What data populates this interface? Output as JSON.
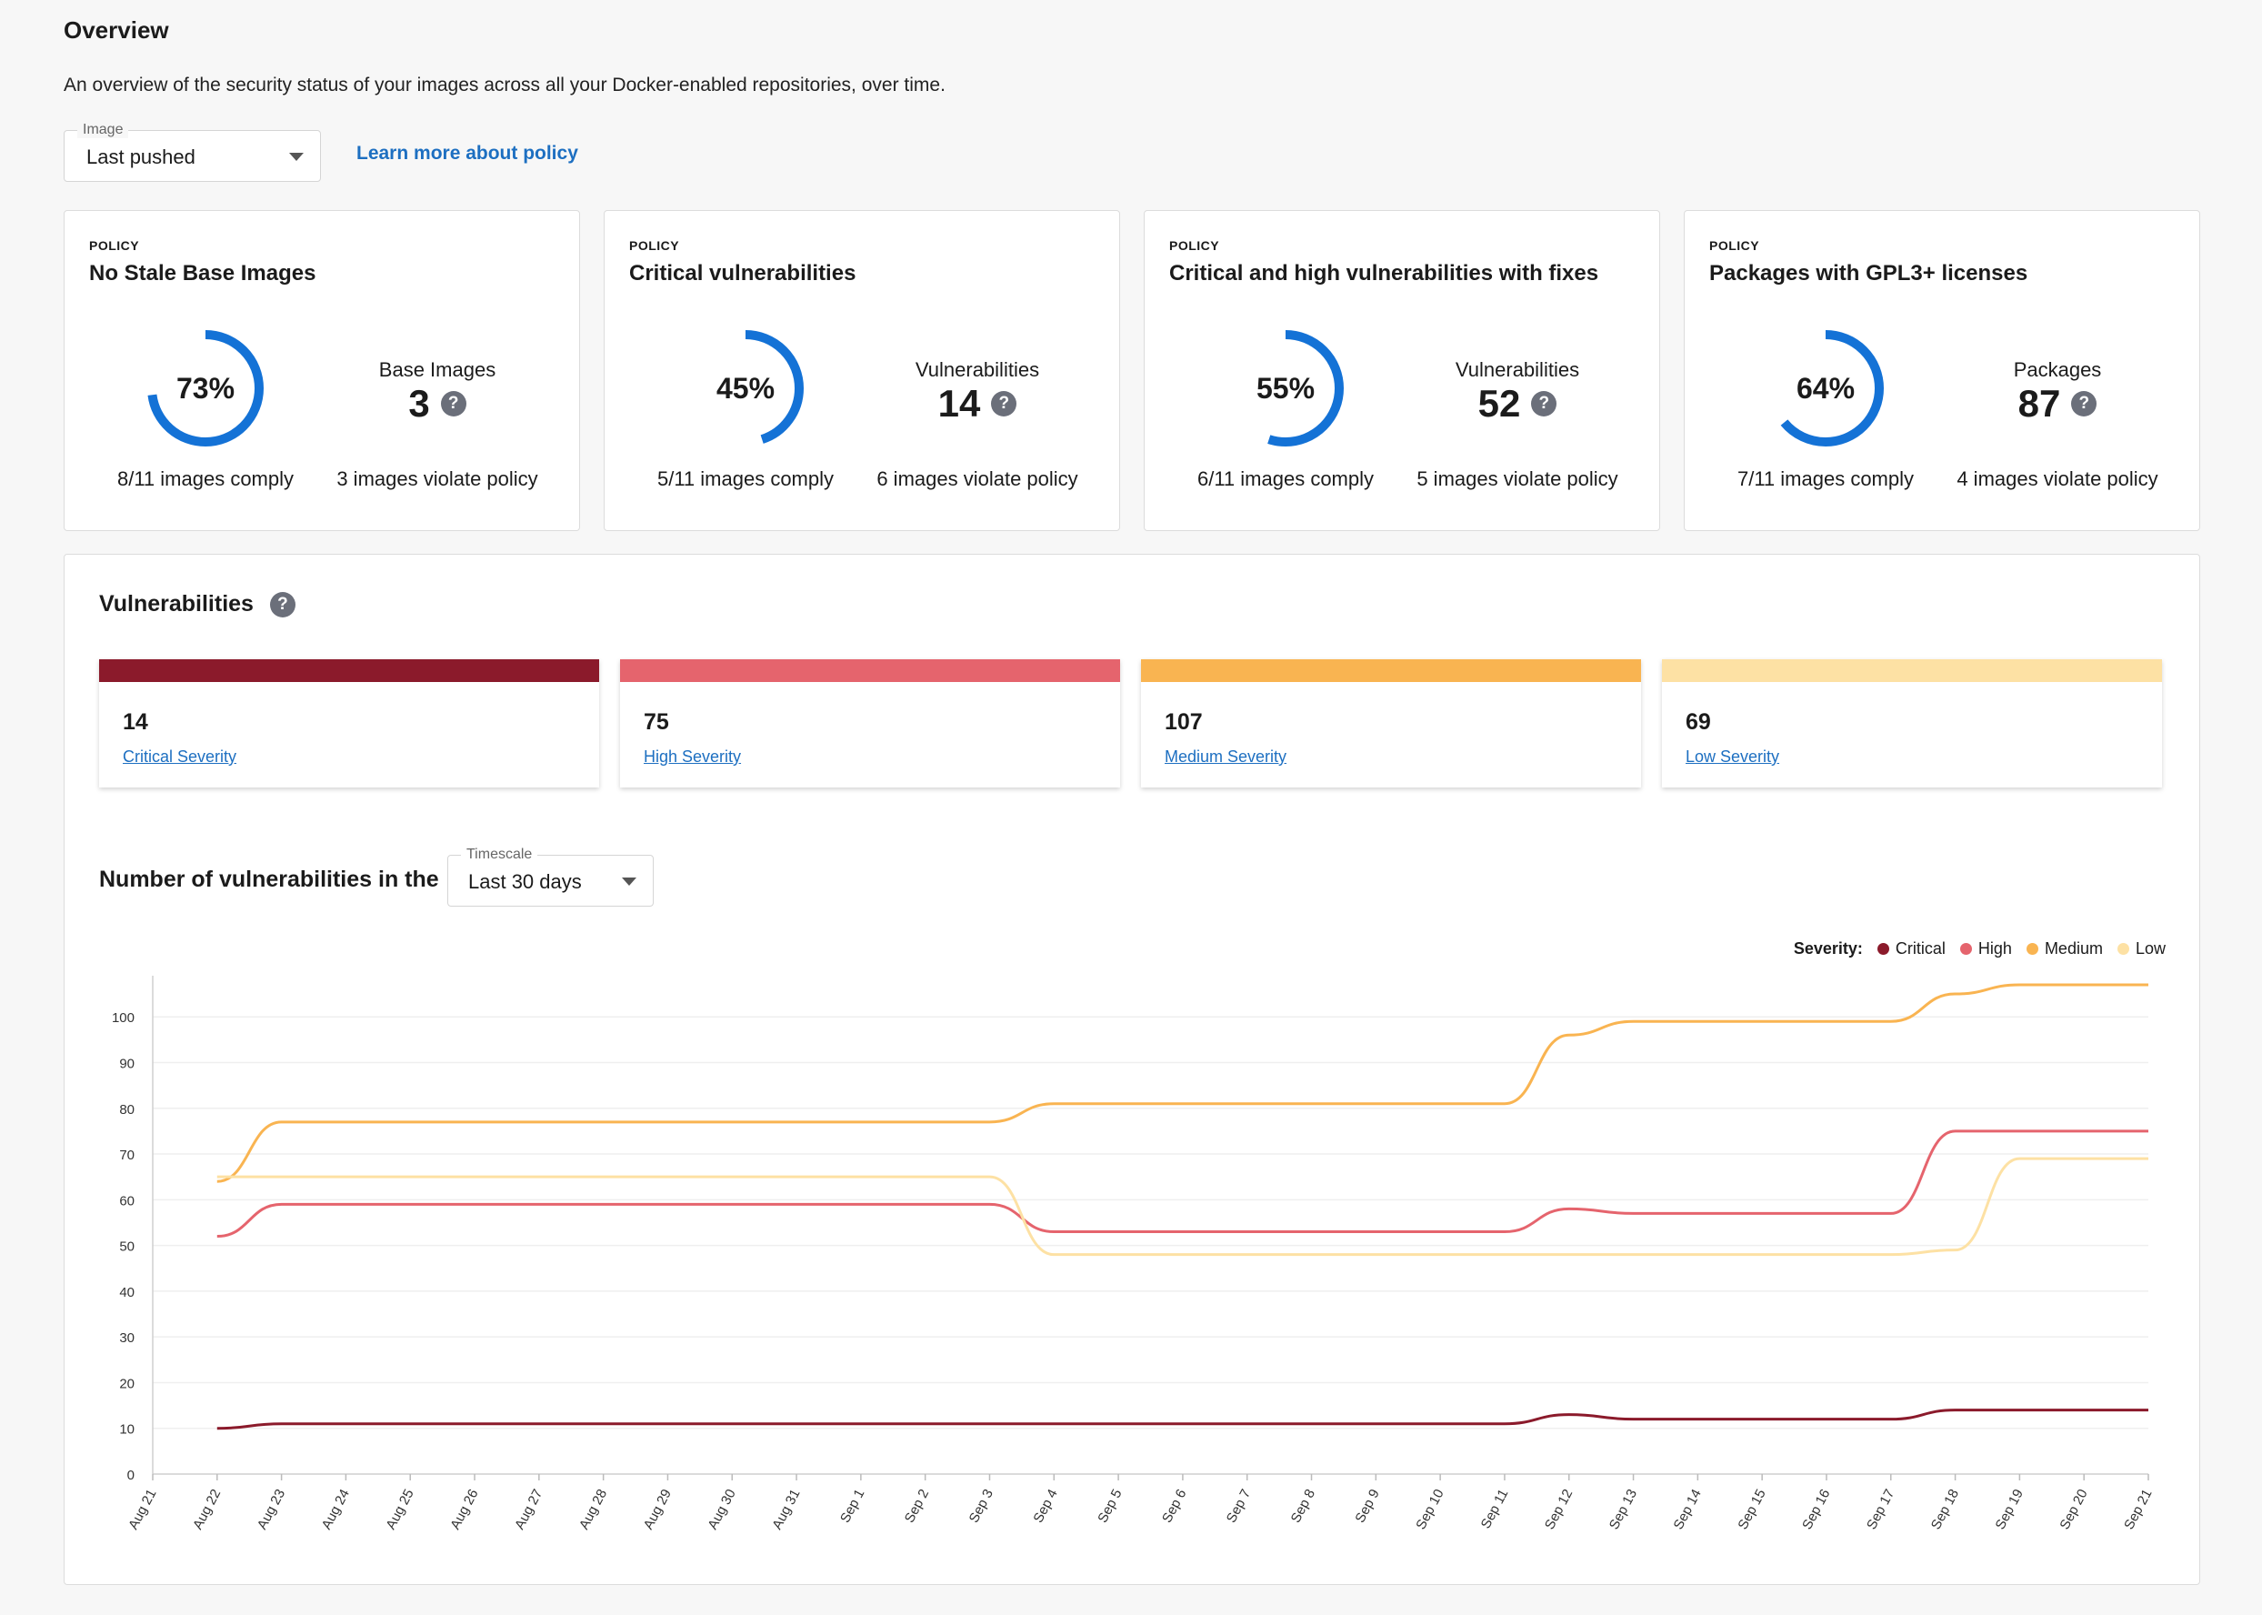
{
  "header": {
    "title": "Overview",
    "description": "An overview of the security status of your images across all your Docker-enabled repositories, over time.",
    "image_select": {
      "label": "Image",
      "value": "Last pushed"
    },
    "learn_more": "Learn more about policy"
  },
  "policies": [
    {
      "label": "POLICY",
      "name": "No Stale Base Images",
      "percent": "73%",
      "fraction": 0.73,
      "metric_label": "Base Images",
      "metric_value": "3",
      "comply": "8/11 images comply",
      "violate": "3 images violate policy"
    },
    {
      "label": "POLICY",
      "name": "Critical vulnerabilities",
      "percent": "45%",
      "fraction": 0.45,
      "metric_label": "Vulnerabilities",
      "metric_value": "14",
      "comply": "5/11 images comply",
      "violate": "6 images violate policy"
    },
    {
      "label": "POLICY",
      "name": "Critical and high vulnerabilities with fixes",
      "percent": "55%",
      "fraction": 0.55,
      "metric_label": "Vulnerabilities",
      "metric_value": "52",
      "comply": "6/11 images comply",
      "violate": "5 images violate policy"
    },
    {
      "label": "POLICY",
      "name": "Packages with GPL3+ licenses",
      "percent": "64%",
      "fraction": 0.64,
      "metric_label": "Packages",
      "metric_value": "87",
      "comply": "7/11 images comply",
      "violate": "4 images violate policy"
    }
  ],
  "vulnerabilities": {
    "title": "Vulnerabilities",
    "severities": [
      {
        "count": "14",
        "label": "Critical Severity",
        "color": "#8b1a2b"
      },
      {
        "count": "75",
        "label": "High Severity",
        "color": "#e5646d"
      },
      {
        "count": "107",
        "label": "Medium Severity",
        "color": "#f9b451"
      },
      {
        "count": "69",
        "label": "Low Severity",
        "color": "#fde1a4"
      }
    ],
    "trend_title": "Number of vulnerabilities in the",
    "timescale": {
      "label": "Timescale",
      "value": "Last 30 days"
    },
    "legend_title": "Severity:"
  },
  "help_glyph": "?",
  "chart_data": {
    "type": "line",
    "x": [
      "Aug 21",
      "Aug 22",
      "Aug 23",
      "Aug 24",
      "Aug 25",
      "Aug 26",
      "Aug 27",
      "Aug 28",
      "Aug 29",
      "Aug 30",
      "Aug 31",
      "Sep 1",
      "Sep 2",
      "Sep 3",
      "Sep 4",
      "Sep 5",
      "Sep 6",
      "Sep 7",
      "Sep 8",
      "Sep 9",
      "Sep 10",
      "Sep 11",
      "Sep 12",
      "Sep 13",
      "Sep 14",
      "Sep 15",
      "Sep 16",
      "Sep 17",
      "Sep 18",
      "Sep 19",
      "Sep 20",
      "Sep 21"
    ],
    "ylim": [
      0,
      107
    ],
    "yticks": [
      0,
      10,
      20,
      30,
      40,
      50,
      60,
      70,
      80,
      90,
      100
    ],
    "series": [
      {
        "name": "Critical",
        "color": "#8b1a2b",
        "values": [
          null,
          10,
          11,
          11,
          11,
          11,
          11,
          11,
          11,
          11,
          11,
          11,
          11,
          11,
          11,
          11,
          11,
          11,
          11,
          11,
          11,
          11,
          13,
          12,
          12,
          12,
          12,
          12,
          14,
          14,
          14,
          14
        ]
      },
      {
        "name": "High",
        "color": "#e5646d",
        "values": [
          null,
          52,
          59,
          59,
          59,
          59,
          59,
          59,
          59,
          59,
          59,
          59,
          59,
          59,
          53,
          53,
          53,
          53,
          53,
          53,
          53,
          53,
          58,
          57,
          57,
          57,
          57,
          57,
          75,
          75,
          75,
          75
        ]
      },
      {
        "name": "Medium",
        "color": "#f9b451",
        "values": [
          null,
          64,
          77,
          77,
          77,
          77,
          77,
          77,
          77,
          77,
          77,
          77,
          77,
          77,
          81,
          81,
          81,
          81,
          81,
          81,
          81,
          81,
          96,
          99,
          99,
          99,
          99,
          99,
          105,
          107,
          107,
          107
        ]
      },
      {
        "name": "Low",
        "color": "#fde1a4",
        "values": [
          null,
          65,
          65,
          65,
          65,
          65,
          65,
          65,
          65,
          65,
          65,
          65,
          65,
          65,
          48,
          48,
          48,
          48,
          48,
          48,
          48,
          48,
          48,
          48,
          48,
          48,
          48,
          48,
          49,
          69,
          69,
          69
        ]
      }
    ],
    "legend_position": "top-right",
    "grid": true
  }
}
